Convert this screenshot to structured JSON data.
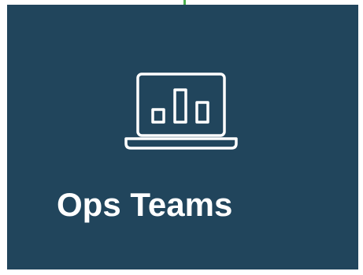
{
  "card": {
    "title": "Ops Teams",
    "icon": "laptop-bar-chart-icon",
    "background_color": "#21455c",
    "text_color": "#ffffff"
  },
  "accent_color": "#4caf50"
}
